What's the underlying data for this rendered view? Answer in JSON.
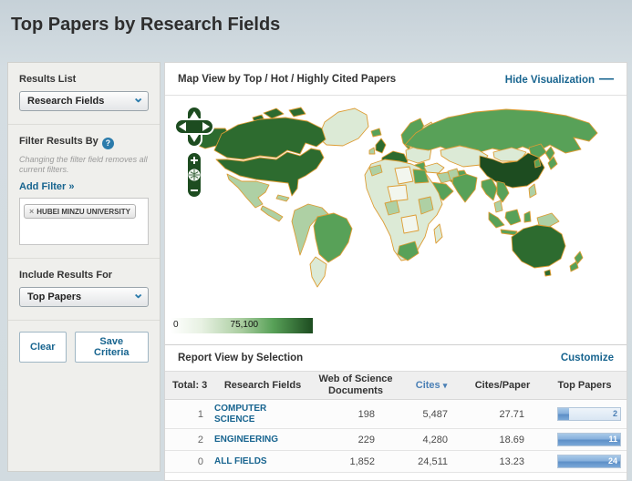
{
  "page": {
    "title": "Top Papers by Research Fields"
  },
  "sidebar": {
    "results_list_label": "Results List",
    "results_list_value": "Research Fields",
    "filter_label": "Filter Results By",
    "help_icon": "?",
    "filter_note": "Changing the filter field removes all current filters.",
    "add_filter_label": "Add Filter »",
    "filter_tag": {
      "remove_icon": "×",
      "label": "HUBEI MINZU UNIVERSITY"
    },
    "include_label": "Include Results For",
    "include_value": "Top Papers",
    "clear_button": "Clear",
    "save_button": "Save Criteria"
  },
  "map": {
    "title": "Map View by Top / Hot / Highly Cited Papers",
    "hide_link": "Hide Visualization",
    "hide_icon": "—",
    "zoom_in_icon": "+",
    "zoom_out_icon": "−",
    "legend_min": "0",
    "legend_max": "75,100"
  },
  "report": {
    "title": "Report View by Selection",
    "customize_link": "Customize",
    "total_label": "Total: 3",
    "columns": {
      "field": "Research Fields",
      "docs": "Web of Science Documents",
      "cites": "Cites",
      "sort_icon": "▾",
      "cites_per_paper": "Cites/Paper",
      "top_papers": "Top Papers"
    },
    "rows": [
      {
        "rank": "1",
        "field": "COMPUTER SCIENCE",
        "docs": "198",
        "cites": "5,487",
        "cites_per_paper": "27.71",
        "top_papers": "2",
        "bar_pct": 17
      },
      {
        "rank": "2",
        "field": "ENGINEERING",
        "docs": "229",
        "cites": "4,280",
        "cites_per_paper": "18.69",
        "top_papers": "11",
        "bar_pct": 100
      },
      {
        "rank": "0",
        "field": "ALL FIELDS",
        "docs": "1,852",
        "cites": "24,511",
        "cites_per_paper": "13.23",
        "top_papers": "24",
        "bar_pct": 100
      }
    ]
  },
  "colors": {
    "link_blue": "#17648f",
    "sort_blue": "#4a7fb5",
    "bar_fill_blue": "#6d9fd4",
    "map_border_orange": "#dd9c33",
    "map_palette": [
      "#f2f6ee",
      "#dcead6",
      "#aed0a4",
      "#58a158",
      "#2d6b2f",
      "#1d4c20"
    ],
    "legend_gradient": [
      "#ffffff",
      "#1d4c20"
    ]
  }
}
